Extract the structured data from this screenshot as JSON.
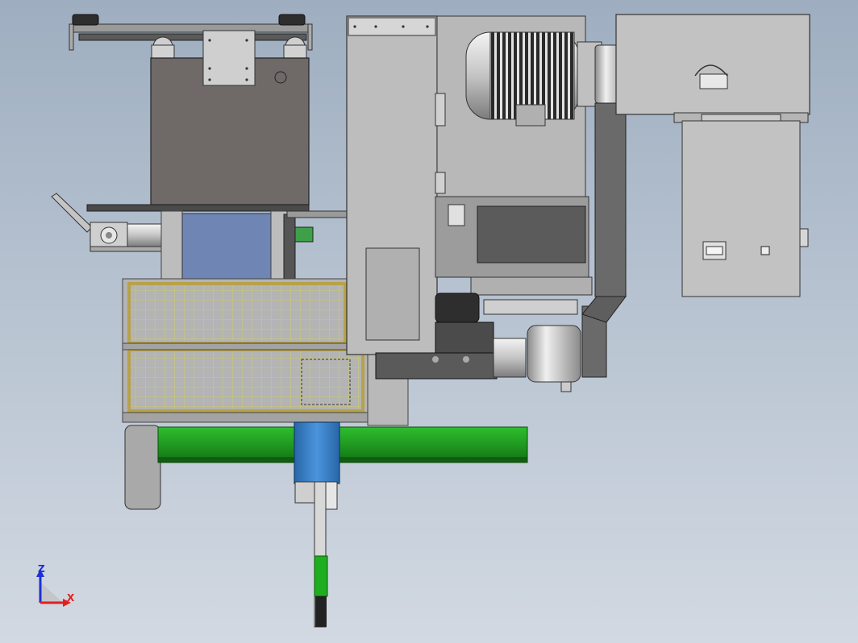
{
  "viewport": {
    "background_top": "#9eaec0",
    "background_bottom": "#d2d9e2"
  },
  "triad": {
    "z_label": "Z",
    "x_label": "X",
    "z_color": "#1e2fd6",
    "x_color": "#e0201f"
  },
  "colors": {
    "housing_dark": "#6f6f6f",
    "frame_gray": "#b9b9b9",
    "guard_yellow": "#c9b75a",
    "green_rail": "#1f9a1f",
    "blue_block": "#2f76c0",
    "blue_panel": "#6f85b4",
    "motor_silver": "#c8c8c8"
  }
}
